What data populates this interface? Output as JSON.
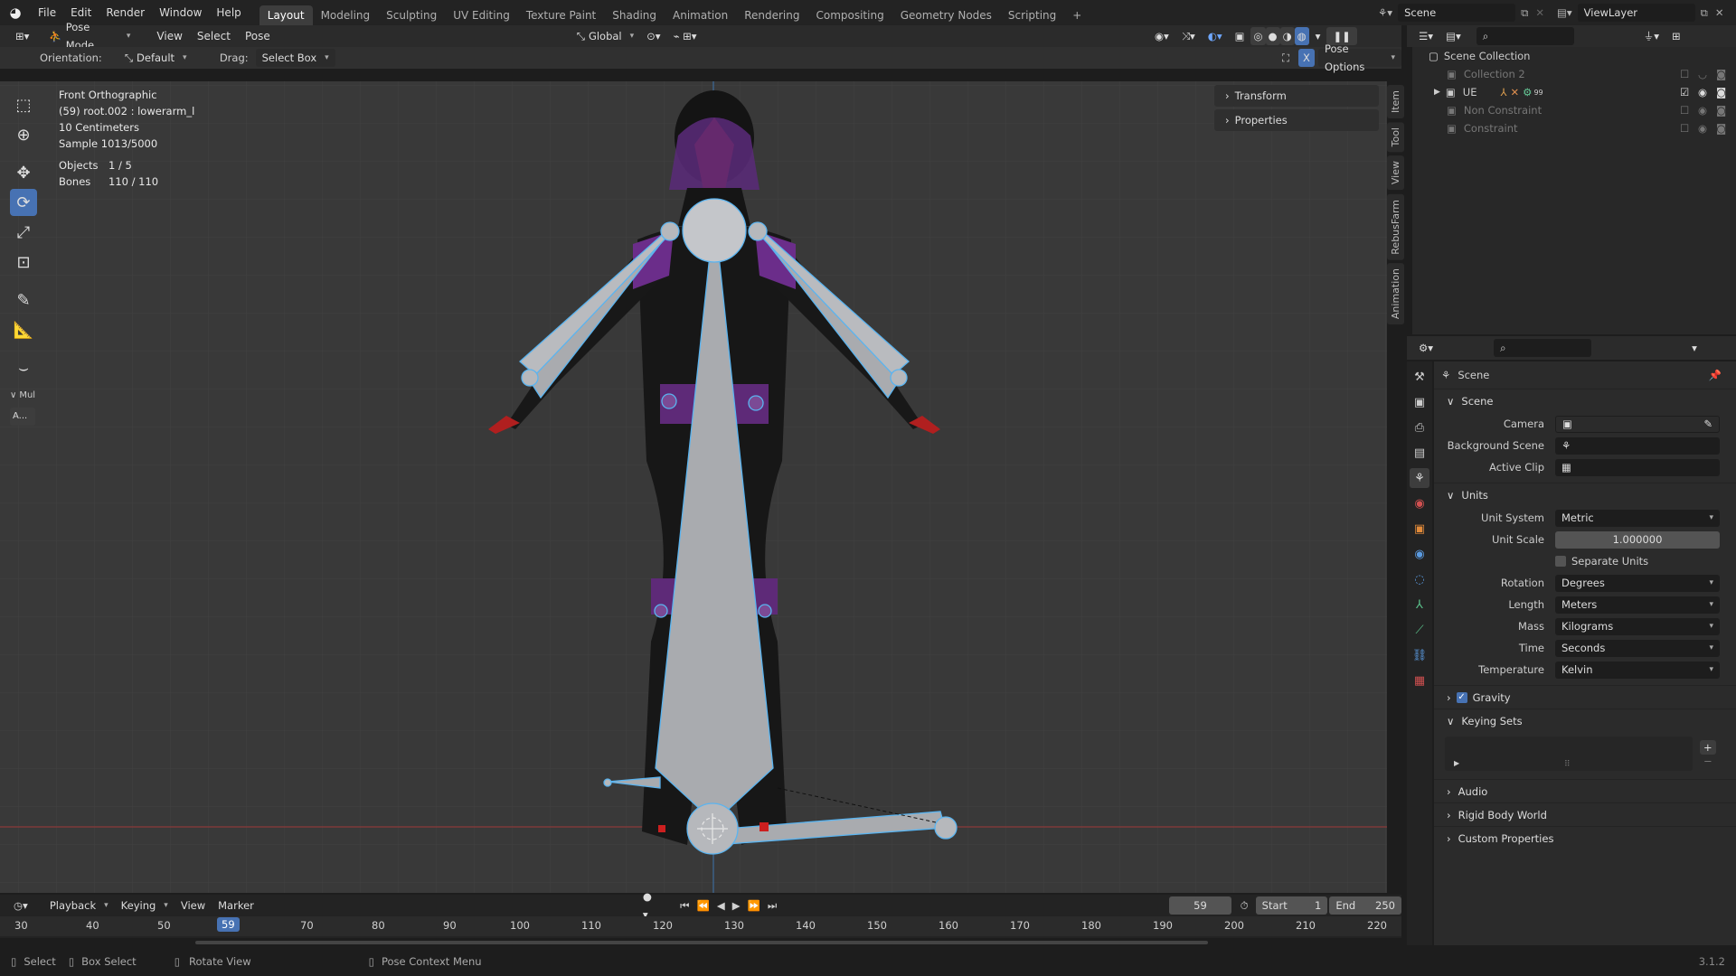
{
  "topbar": {
    "menus": [
      "File",
      "Edit",
      "Render",
      "Window",
      "Help"
    ],
    "workspaces": [
      "Layout",
      "Modeling",
      "Sculpting",
      "UV Editing",
      "Texture Paint",
      "Shading",
      "Animation",
      "Rendering",
      "Compositing",
      "Geometry Nodes",
      "Scripting"
    ],
    "active_workspace": "Layout",
    "scene": "Scene",
    "view_layer": "ViewLayer"
  },
  "viewport_header": {
    "mode": "Pose Mode",
    "menus": [
      "View",
      "Select",
      "Pose"
    ],
    "transform_orientation": "Global",
    "orientation_label": "Orientation:",
    "orientation_value": "Default",
    "drag_label": "Drag:",
    "drag_value": "Select Box",
    "pose_options": "Pose Options",
    "x_mirror": "X"
  },
  "overlay": {
    "view_name": "Front Orthographic",
    "active": "(59) root.002 : lowerarm_l",
    "scale": "10 Centimeters",
    "sample": "Sample 1013/5000",
    "objects_label": "Objects",
    "objects_value": "1 / 5",
    "bones_label": "Bones",
    "bones_value": "110 / 110"
  },
  "toolbar": {
    "collapsed_label": "Mul",
    "small_button": "A..."
  },
  "npanel": {
    "sections": [
      "Transform",
      "Properties"
    ],
    "tabs": [
      "Item",
      "Tool",
      "View",
      "RebusFarm",
      "Animation"
    ]
  },
  "outliner": {
    "root": "Scene Collection",
    "items": [
      {
        "label": "Collection 2",
        "muted": true,
        "indent": 1
      },
      {
        "label": "UE",
        "muted": false,
        "indent": 1,
        "badge": "99"
      },
      {
        "label": "Non Constraint",
        "muted": true,
        "indent": 1
      },
      {
        "label": "Constraint",
        "muted": true,
        "indent": 1
      }
    ]
  },
  "properties": {
    "context": "Scene",
    "scene_section": "Scene",
    "camera_label": "Camera",
    "background_scene_label": "Background Scene",
    "active_clip_label": "Active Clip",
    "units_section": "Units",
    "unit_system_label": "Unit System",
    "unit_system": "Metric",
    "unit_scale_label": "Unit Scale",
    "unit_scale": "1.000000",
    "separate_units": "Separate Units",
    "rotation_label": "Rotation",
    "rotation": "Degrees",
    "length_label": "Length",
    "length": "Meters",
    "mass_label": "Mass",
    "mass": "Kilograms",
    "time_label": "Time",
    "time": "Seconds",
    "temperature_label": "Temperature",
    "temperature": "Kelvin",
    "gravity": "Gravity",
    "keying_sets": "Keying Sets",
    "audio": "Audio",
    "rigid_body_world": "Rigid Body World",
    "custom_properties": "Custom Properties"
  },
  "timeline": {
    "menus": [
      "Playback",
      "Keying",
      "View",
      "Marker"
    ],
    "current_frame": "59",
    "start_label": "Start",
    "start": "1",
    "end_label": "End",
    "end": "250",
    "ticks": [
      "30",
      "40",
      "50",
      "59",
      "70",
      "80",
      "90",
      "100",
      "110",
      "120",
      "130",
      "140",
      "150",
      "160",
      "170",
      "180",
      "190",
      "200",
      "210",
      "220"
    ]
  },
  "statusbar": {
    "select": "Select",
    "box_select": "Box Select",
    "rotate_view": "Rotate View",
    "context_menu": "Pose Context Menu",
    "version": "3.1.2"
  },
  "colors": {
    "accent": "#4772b3",
    "bone": "#a9abaf",
    "bone_outline": "#5ab4f0"
  }
}
